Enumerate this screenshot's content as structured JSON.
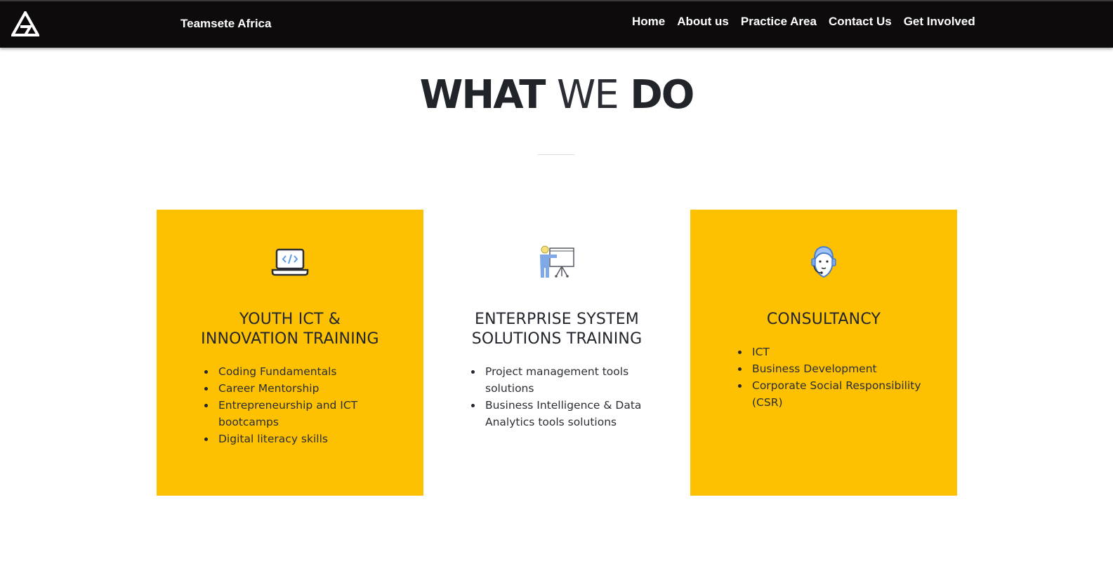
{
  "navbar": {
    "brand": "Teamsete Africa",
    "links": [
      "Home",
      "About us",
      "Practice Area",
      "Contact Us",
      "Get Involved"
    ]
  },
  "section": {
    "title_part1": "WHAT",
    "title_part2": "WE",
    "title_part3": "DO"
  },
  "cards": [
    {
      "icon": "laptop-code-icon",
      "title_line1": "YOUTH ICT &",
      "title_line2": "INNOVATION TRAINING",
      "items": [
        "Coding Fundamentals",
        "Career Mentorship",
        "Entrepreneurship and ICT bootcamps",
        "Digital literacy skills"
      ]
    },
    {
      "icon": "presenter-whiteboard-icon",
      "title_line1": "ENTERPRISE SYSTEM",
      "title_line2": "SOLUTIONS TRAINING",
      "items": [
        "Project management tools solutions",
        "Business Intelligence & Data Analytics tools solutions"
      ]
    },
    {
      "icon": "support-agent-icon",
      "title_line1": "CONSULTANCY",
      "title_line2": "",
      "items": [
        "ICT",
        "Business Development",
        "Corporate Social Responsibility (CSR)"
      ]
    }
  ],
  "colors": {
    "navbar_bg": "#0d0b0c",
    "card_accent": "#fdc101",
    "text_dark": "#23262d",
    "icon_blue": "#7fa9e6"
  }
}
